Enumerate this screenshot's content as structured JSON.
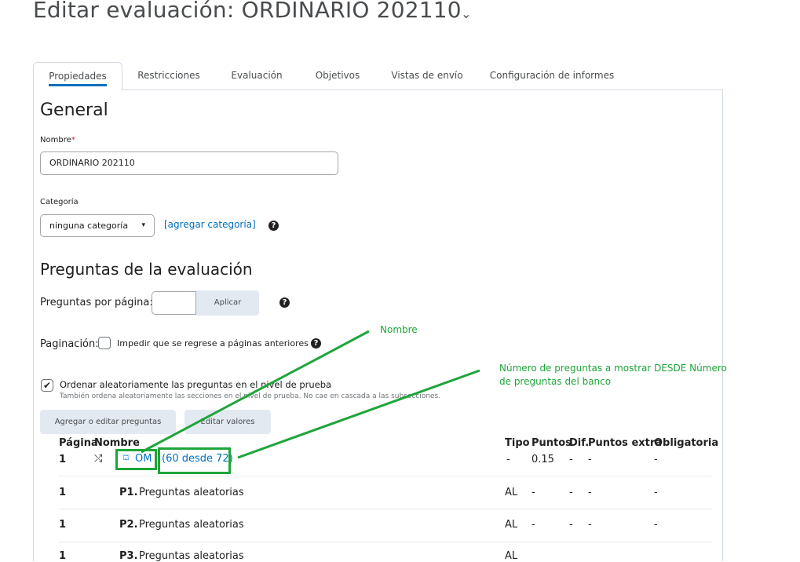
{
  "page": {
    "title": "Editar evaluación: ORDINARIO 202110",
    "title_chevron": "⌄"
  },
  "tabs": [
    {
      "label": "Propiedades",
      "active": true
    },
    {
      "label": "Restricciones"
    },
    {
      "label": "Evaluación"
    },
    {
      "label": "Objetivos"
    },
    {
      "label": "Vistas de envío"
    },
    {
      "label": "Configuración de informes"
    }
  ],
  "general": {
    "heading": "General",
    "name_label": "Nombre",
    "name_required_mark": "*",
    "name_value": "ORDINARIO 202110",
    "category_label": "Categoría",
    "category_value": "ninguna categoría",
    "add_category_link": "[agregar categoría]"
  },
  "questions": {
    "heading": "Preguntas de la evaluación",
    "per_page_label": "Preguntas por página:",
    "per_page_value": "",
    "apply_button": "Aplicar",
    "pagination_label": "Paginación:",
    "pagination_option": "Impedir que se regrese a páginas anteriores",
    "randomize_label": "Ordenar aleatoriamente las preguntas en el nivel de prueba",
    "randomize_checked": true,
    "randomize_help": "También ordena aleatoriamente las secciones en el nivel de prueba. No cae en cascada a las subsecciones.",
    "add_edit_button": "Agregar o editar preguntas",
    "edit_values_button": "Editar valores"
  },
  "table": {
    "headers": [
      "Página",
      "Nombre",
      "Tipo",
      "Puntos",
      "Dif.",
      "Puntos extra",
      "Obligatoria"
    ],
    "rows": [
      {
        "page": "1",
        "name_prefix": "",
        "name_link": "OM",
        "name_suffix": "(60 desde 72)",
        "type": "-",
        "points": "0.15",
        "dif": "-",
        "extra": "-",
        "required": "-"
      },
      {
        "page": "1",
        "name_prefix": "P1.",
        "name_text": "Preguntas aleatorias",
        "type": "AL",
        "points": "-",
        "dif": "-",
        "extra": "-",
        "required": "-"
      },
      {
        "page": "1",
        "name_prefix": "P2.",
        "name_text": "Preguntas aleatorias",
        "type": "AL",
        "points": "-",
        "dif": "-",
        "extra": "-",
        "required": "-"
      },
      {
        "page": "1",
        "name_prefix": "P3.",
        "name_text": "Preguntas aleatorias",
        "type": "AL",
        "points": "-",
        "dif": "-",
        "extra": "-",
        "required": "-"
      }
    ]
  },
  "annotations": {
    "nombre": "Nombre",
    "count": "Número de preguntas a mostrar DESDE Número de preguntas del banco",
    "color": "#1fa53a"
  },
  "colors": {
    "accent": "#006fbf",
    "annotation": "#1fa53a"
  }
}
